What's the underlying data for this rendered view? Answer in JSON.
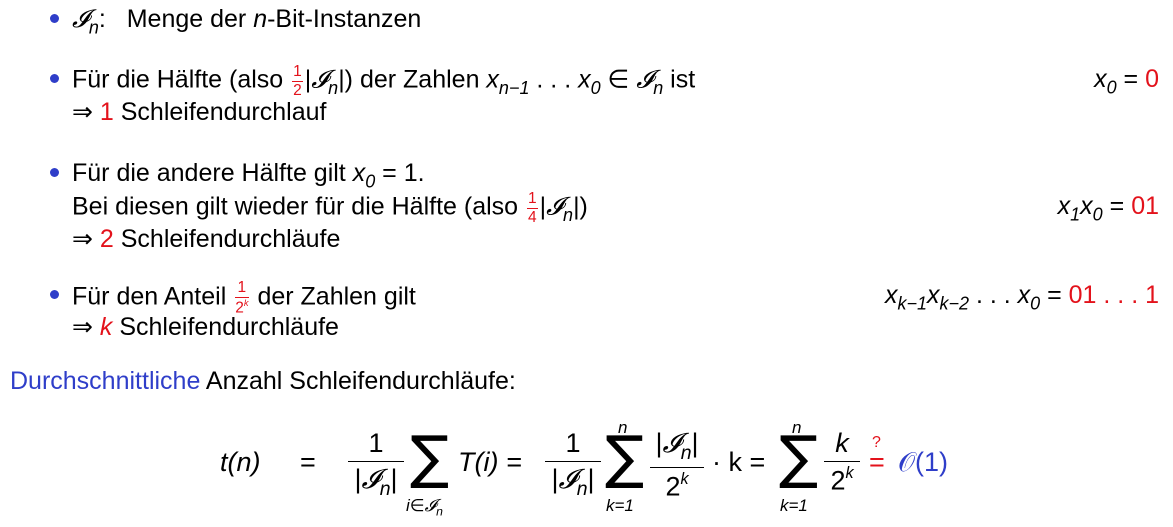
{
  "items": [
    {
      "symbol": "𝓘",
      "symbol_sub": "n",
      "colon": ":",
      "text_pre": "Menge der ",
      "text_var": "n",
      "text_post": "-Bit-Instanzen"
    },
    {
      "line1_pre": "Für die Hälfte (also ",
      "frac_num": "1",
      "frac_den": "2",
      "line1_bar_open": "|",
      "line1_symbol": "𝓘",
      "line1_symbol_sub": "n",
      "line1_bar_close": "|) der Zahlen ",
      "line1_x1": "x",
      "line1_x1_sub": "n−1",
      "line1_dots": " . . . ",
      "line1_x0": "x",
      "line1_x0_sub": "0",
      "line1_in": " ∈ ",
      "line1_set": "𝓘",
      "line1_set_sub": "n",
      "line1_post": " ist",
      "right_var": "x",
      "right_var_sub": "0",
      "right_eq": " = ",
      "right_val": "0",
      "line2_arrow": "⇒ ",
      "line2_num": "1",
      "line2_text": " Schleifendurchlauf"
    },
    {
      "line1_pre": "Für die andere Hälfte gilt ",
      "line1_var": "x",
      "line1_var_sub": "0",
      "line1_post": " = 1.",
      "line2_pre": "Bei diesen gilt wieder für die Hälfte (also ",
      "frac_num": "1",
      "frac_den": "4",
      "line2_bar_open": "|",
      "line2_symbol": "𝓘",
      "line2_symbol_sub": "n",
      "line2_post": "|)",
      "right_var1": "x",
      "right_var1_sub": "1",
      "right_var0": "x",
      "right_var0_sub": "0",
      "right_eq": " = ",
      "right_val": "01",
      "line3_arrow": "⇒ ",
      "line3_num": "2",
      "line3_text": " Schleifendurchläufe"
    },
    {
      "line1_pre": "Für den Anteil ",
      "frac_num": "1",
      "frac_den_base": "2",
      "frac_den_exp": "k",
      "line1_post": " der Zahlen gilt",
      "right_v1": "x",
      "right_v1_sub": "k−1",
      "right_v2": "x",
      "right_v2_sub": "k−2",
      "right_dots": " . . . ",
      "right_v3": "x",
      "right_v3_sub": "0",
      "right_eq": " = ",
      "right_val": "01 . . . 1",
      "line2_arrow": "⇒ ",
      "line2_var": "k",
      "line2_text": " Schleifendurchläufe"
    }
  ],
  "summary": {
    "highlight": "Durchschnittliche",
    "rest": " Anzahl Schleifendurchläufe:"
  },
  "formula": {
    "lhs": "t(n)",
    "eq": "=",
    "f1_num": "1",
    "f1_den_open": "|",
    "f1_den_sym": "𝓘",
    "f1_den_sub": "n",
    "f1_den_close": "|",
    "sum_symbol": "∑",
    "sum1_lower": "i∈𝓘",
    "sum1_lower_sub": "n",
    "term1": "T(i) =",
    "f2_num": "1",
    "f2_den_open": "|",
    "f2_den_sym": "𝓘",
    "f2_den_sub": "n",
    "f2_den_close": "|",
    "sum2_upper": "n",
    "sum2_lower": "k=1",
    "f3_num_open": "|",
    "f3_num_sym": "𝓘",
    "f3_num_sub": "n",
    "f3_num_close": "|",
    "f3_den_base": "2",
    "f3_den_exp": "k",
    "times_k": "· k =",
    "sum3_upper": "n",
    "sum3_lower": "k=1",
    "f4_num": "k",
    "f4_den_base": "2",
    "f4_den_exp": "k",
    "q_mark": "?",
    "q_eq": "=",
    "bigO": "𝒪(1)"
  },
  "colors": {
    "accent_red": "#e3121b",
    "accent_blue": "#2f3ec9",
    "text": "#000000"
  }
}
